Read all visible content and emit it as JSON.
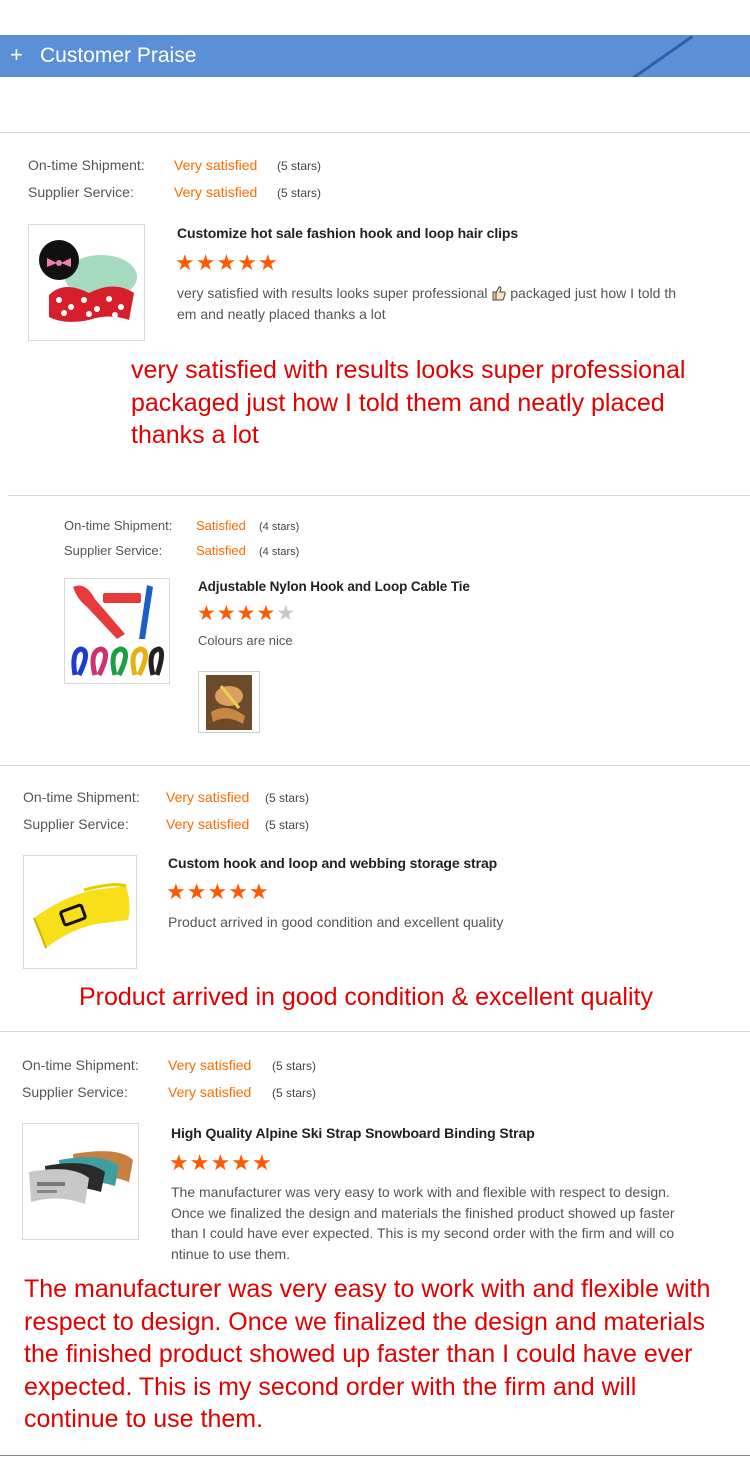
{
  "header": {
    "plus": "+",
    "title": "Customer Praise"
  },
  "labels": {
    "shipment": "On-time Shipment:",
    "service": "Supplier Service:"
  },
  "reviews": [
    {
      "shipment_value": "Very satisfied",
      "shipment_stars": "(5 stars)",
      "service_value": "Very satisfied",
      "service_stars": "(5 stars)",
      "product_title": "Customize hot sale fashion hook and loop hair clips",
      "rating": 5,
      "review_text": "very satisfied with results looks super professional 👍 packaged just how I told them and neatly placed thanks a lot",
      "review_line1": "very satisfied with results looks super professional",
      "review_line1b": "packaged just how I told th",
      "review_line2": "em and neatly placed thanks a lot",
      "thumb_icon": "hair-clip-product-image",
      "caption": "very satisfied with results looks super professional packaged just how I told them and neatly placed thanks a lot"
    },
    {
      "shipment_value": "Satisfied",
      "shipment_stars": "(4 stars)",
      "service_value": "Satisfied",
      "service_stars": "(4 stars)",
      "product_title": "Adjustable Nylon Hook and Loop Cable Tie",
      "rating": 4,
      "review_text": "Colours are nice",
      "thumb_icon": "cable-tie-product-image",
      "photo_icon": "customer-photo-thumbnail",
      "photo_label": ""
    },
    {
      "shipment_value": "Very satisfied",
      "shipment_stars": "(5 stars)",
      "service_value": "Very satisfied",
      "service_stars": "(5 stars)",
      "product_title": "Custom hook and loop and webbing storage strap",
      "rating": 5,
      "review_text": "Product arrived in good condition and excellent quality",
      "thumb_icon": "storage-strap-product-image",
      "caption": "Product arrived in good condition & excellent quality"
    },
    {
      "shipment_value": "Very satisfied",
      "shipment_stars": "(5 stars)",
      "service_value": "Very satisfied",
      "service_stars": "(5 stars)",
      "product_title": "High Quality Alpine Ski Strap Snowboard Binding Strap",
      "rating": 5,
      "review_lines": [
        "The manufacturer was very easy to work with and flexible with respect to design.",
        "Once we finalized the design and materials the finished product showed up faster",
        "than I could have ever expected. This is my second order with the firm and will co",
        "ntinue to use them."
      ],
      "thumb_icon": "ski-strap-product-image",
      "caption": "The manufacturer was very easy to work with and flexible with respect to design. Once we finalized the design and materials the finished product showed up faster than I could have ever expected. This is my second order with the firm and will continue to use them."
    }
  ],
  "colors": {
    "header": "#5b8fd6",
    "accent": "#ff6a00",
    "caption_red": "#e20000",
    "star": "#ff5a00"
  }
}
